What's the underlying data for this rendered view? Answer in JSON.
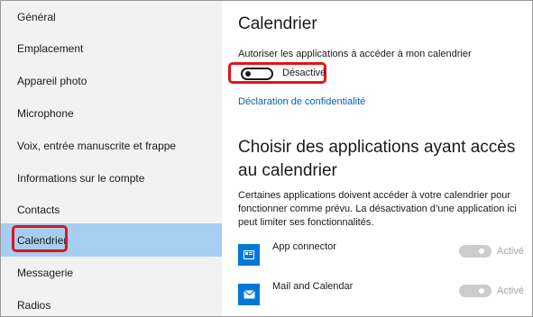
{
  "sidebar": {
    "items": [
      {
        "label": "Général"
      },
      {
        "label": "Emplacement"
      },
      {
        "label": "Appareil photo"
      },
      {
        "label": "Microphone"
      },
      {
        "label": "Voix, entrée manuscrite et frappe"
      },
      {
        "label": "Informations sur le compte"
      },
      {
        "label": "Contacts"
      },
      {
        "label": "Calendrier",
        "selected": true
      },
      {
        "label": "Messagerie"
      },
      {
        "label": "Radios"
      }
    ]
  },
  "main": {
    "title": "Calendrier",
    "allow_label": "Autoriser les applications à accéder à mon calendrier",
    "toggle": {
      "state": "off",
      "label": "Désactivé"
    },
    "privacy_link": "Déclaration de confidentialité",
    "section_title": "Choisir des applications ayant accès au calendrier",
    "section_desc": "Certaines applications doivent accéder à votre calendrier pour fonctionner comme prévu. La désactivation d’une application ici peut limiter ses fonctionnalités.",
    "apps": [
      {
        "name": "App connector",
        "icon": "app-connector-icon",
        "status": "Activé",
        "state": "on-disabled"
      },
      {
        "name": "Mail and Calendar",
        "icon": "mail-icon",
        "status": "Activé",
        "state": "on-disabled"
      }
    ]
  },
  "colors": {
    "selected_bg": "#a7cdf0",
    "highlight": "#e0141b",
    "link": "#0063b1",
    "app_icon_bg": "#0078d7"
  }
}
